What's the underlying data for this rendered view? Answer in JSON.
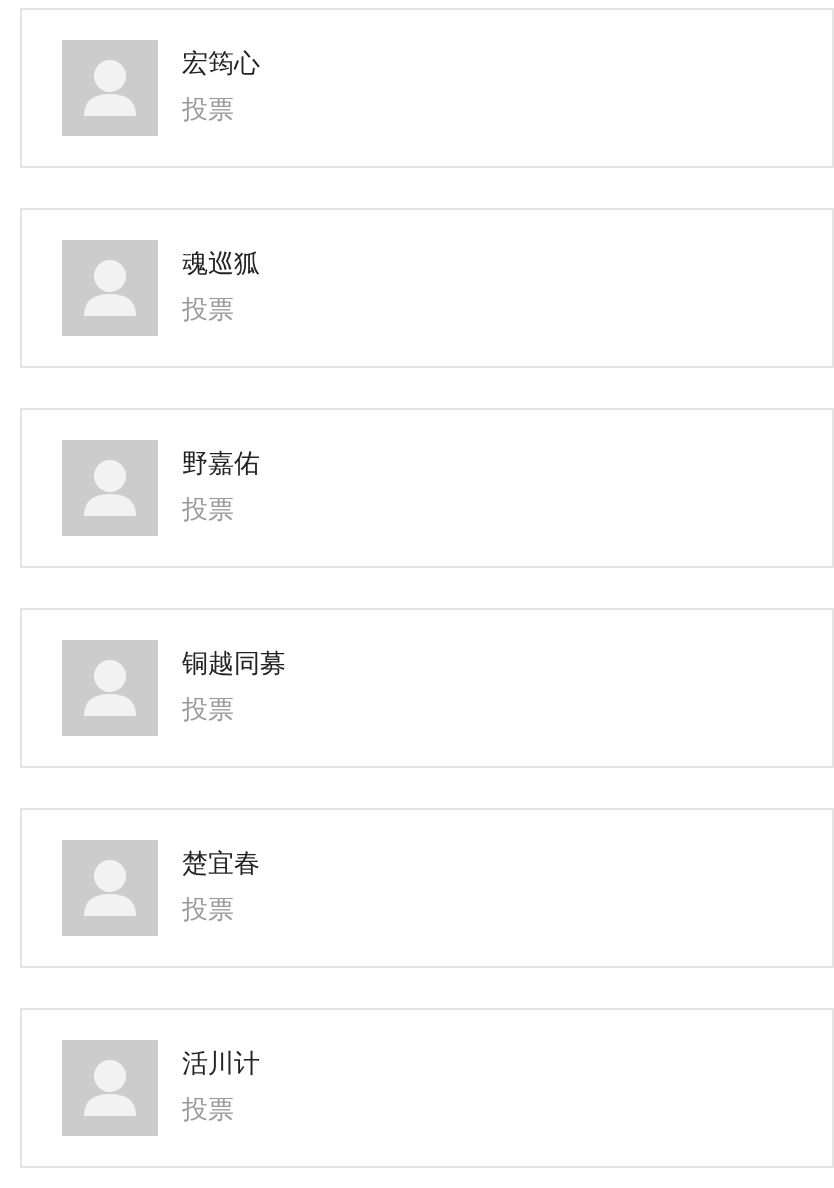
{
  "candidates": [
    {
      "name": "宏筠心",
      "action": "投票"
    },
    {
      "name": "魂巡狐",
      "action": "投票"
    },
    {
      "name": "野嘉佑",
      "action": "投票"
    },
    {
      "name": "铜越同募",
      "action": "投票"
    },
    {
      "name": "楚宜春",
      "action": "投票"
    },
    {
      "name": "活川计",
      "action": "投票"
    }
  ]
}
